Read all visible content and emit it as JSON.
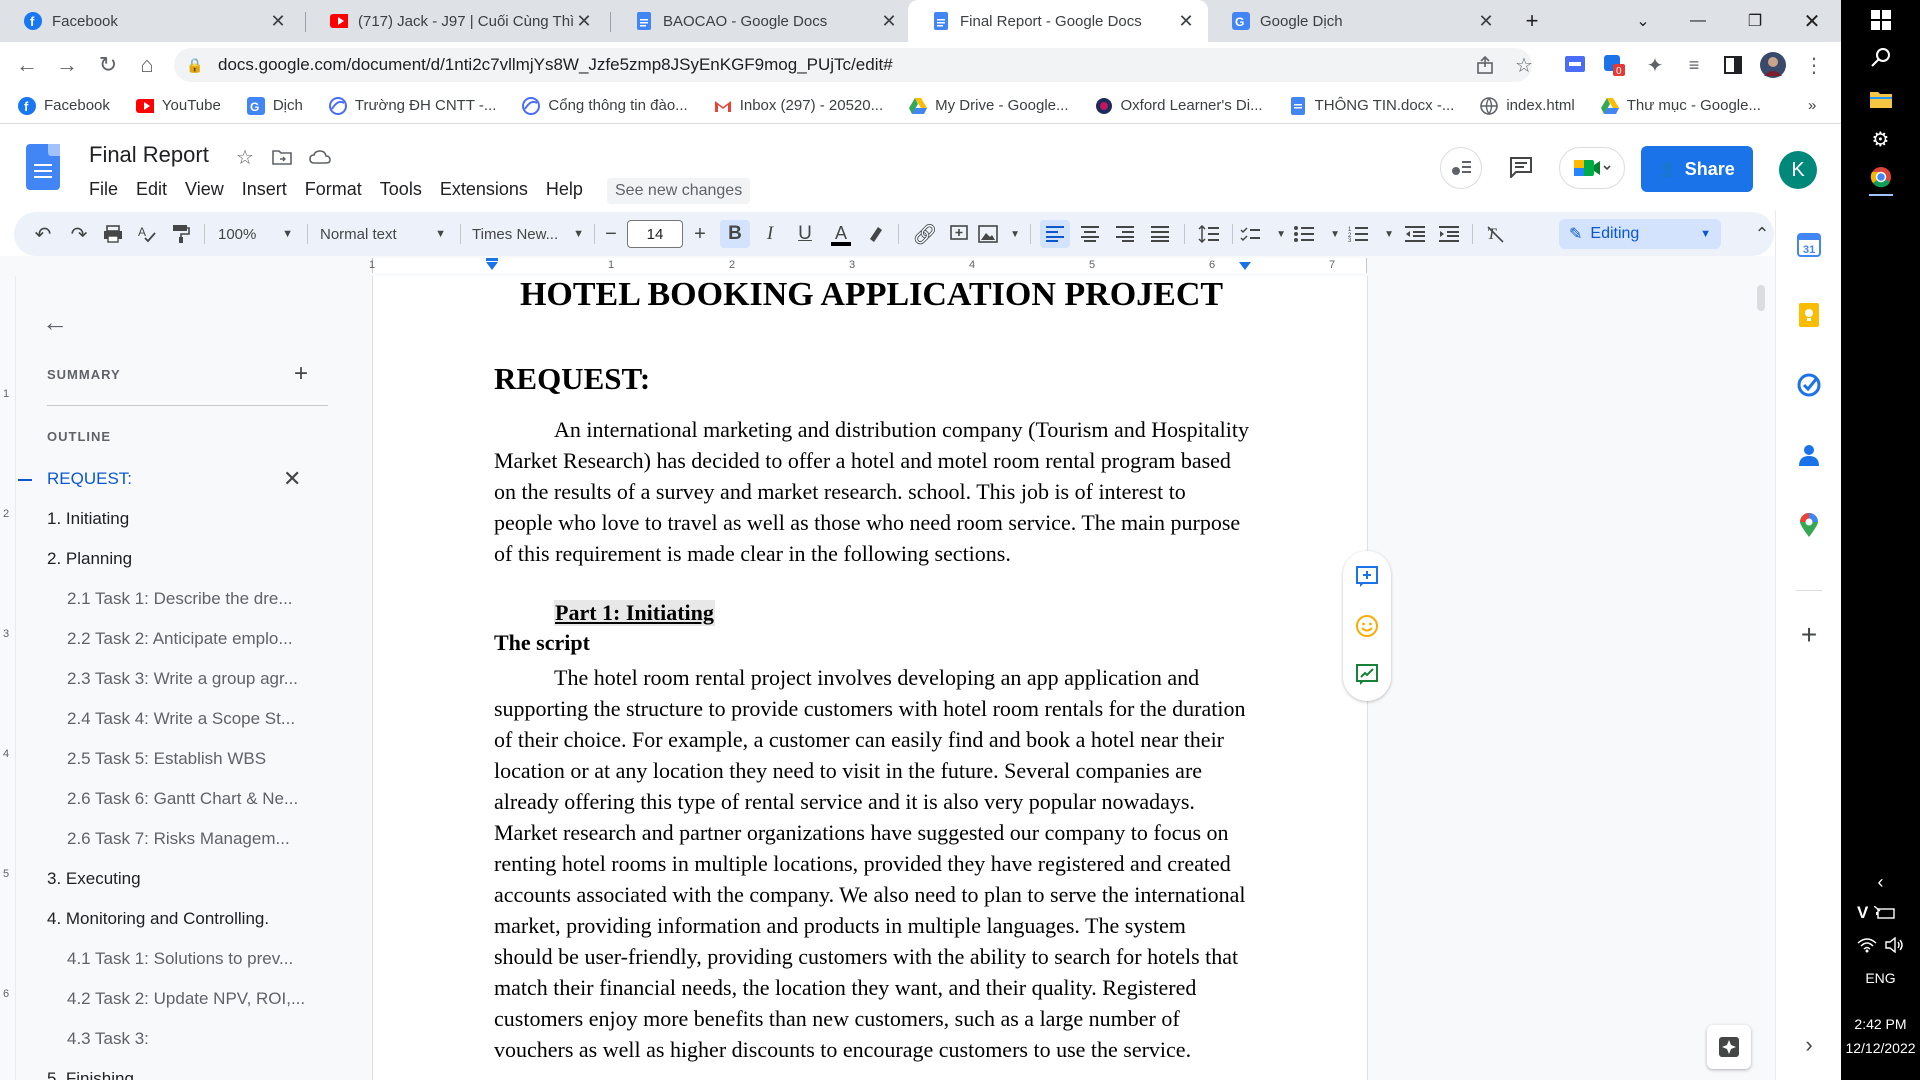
{
  "tabs": [
    {
      "title": "Facebook",
      "active": false
    },
    {
      "title": "(717) Jack - J97 | Cuối Cùng Thì |",
      "active": false
    },
    {
      "title": "BAOCAO - Google Docs",
      "active": false
    },
    {
      "title": "Final Report - Google Docs",
      "active": true
    },
    {
      "title": "Google Dịch",
      "active": false
    }
  ],
  "url": "docs.google.com/document/d/1nti2c7vllmjYs8W_Jzfe5zmp8JSyEnKGF9mog_PUjTc/edit#",
  "bookmarks": [
    "Facebook",
    "YouTube",
    "Dịch",
    "Trường ĐH CNTT -...",
    "Cổng thông tin đào...",
    "Inbox (297) - 20520...",
    "My Drive - Google...",
    "Oxford Learner's Di...",
    "THÔNG TIN.docx -...",
    "index.html",
    "Thư mục - Google..."
  ],
  "extension_badge": "0",
  "doc": {
    "title": "Final Report",
    "menus": [
      "File",
      "Edit",
      "View",
      "Insert",
      "Format",
      "Tools",
      "Extensions",
      "Help"
    ],
    "see_new_changes": "See new changes",
    "share_label": "Share",
    "avatar_letter": "K"
  },
  "toolbar": {
    "zoom": "100%",
    "style": "Normal text",
    "font": "Times New...",
    "font_size": "14",
    "mode": "Editing"
  },
  "ruler_numbers": [
    "1",
    "1",
    "2",
    "3",
    "4",
    "5",
    "6",
    "7"
  ],
  "vruler_numbers": [
    "1",
    "2",
    "3",
    "4",
    "5",
    "6"
  ],
  "outline": {
    "summary_heading": "SUMMARY",
    "outline_heading": "OUTLINE",
    "items": [
      {
        "label": "REQUEST:",
        "level": 0,
        "current": true
      },
      {
        "label": "1. Initiating",
        "level": 0
      },
      {
        "label": "2. Planning",
        "level": 0
      },
      {
        "label": "2.1 Task 1: Describe the dre...",
        "level": 1
      },
      {
        "label": "2.2 Task 2: Anticipate emplo...",
        "level": 1
      },
      {
        "label": "2.3 Task 3: Write a group agr...",
        "level": 1
      },
      {
        "label": "2.4 Task 4: Write a Scope St...",
        "level": 1
      },
      {
        "label": "2.5 Task 5: Establish WBS",
        "level": 1
      },
      {
        "label": "2.6 Task 6: Gantt Chart & Ne...",
        "level": 1
      },
      {
        "label": "2.6 Task 7: Risks Managem...",
        "level": 1
      },
      {
        "label": "3. Executing",
        "level": 0
      },
      {
        "label": "4. Monitoring and Controlling.",
        "level": 0
      },
      {
        "label": "4.1 Task 1: Solutions to prev...",
        "level": 1
      },
      {
        "label": "4.2 Task 2: Update NPV, ROI,...",
        "level": 1
      },
      {
        "label": "4.3 Task 3:",
        "level": 1
      },
      {
        "label": "5. Finishing",
        "level": 0
      }
    ]
  },
  "content": {
    "heading1": "HOTEL BOOKING APPLICATION PROJECT",
    "heading2": "REQUEST:",
    "para1": "An international marketing and distribution company (Tourism and Hospitality Market Research) has decided to offer a hotel and motel room rental program based on the results of a survey and market research. school. This job is of interest to people who love to travel as well as those who need room service. The main purpose of this requirement is made clear in the following sections.",
    "part1": "Part 1: Initiating",
    "script_heading": "The script",
    "para2": "The hotel room rental project involves developing an app application and supporting the structure to provide customers with hotel room rentals for the duration of their choice. For example, a customer can easily find and book a hotel near their location or at any location they need to visit in the future. Several companies are already offering this type of rental service and it is also very popular nowadays. Market research and partner organizations have suggested our company to focus on renting hotel rooms in multiple locations, provided they have registered and created accounts associated with the company. We also need to plan to serve the international market, providing information and products in multiple languages. The system should be user-friendly, providing customers with the ability to search for hotels that match their financial needs, the location they want, and their quality. Registered customers enjoy more benefits than new customers, such as a large number of vouchers as well as higher discounts to encourage customers to use the service."
  },
  "taskbar": {
    "lang": "ENG",
    "time": "2:42 PM",
    "date": "12/12/2022",
    "v_label": "V"
  },
  "colors": {
    "accent": "#1a73e8",
    "toolbar_bg": "#edf2fa",
    "outline_current": "#0b57d0"
  }
}
